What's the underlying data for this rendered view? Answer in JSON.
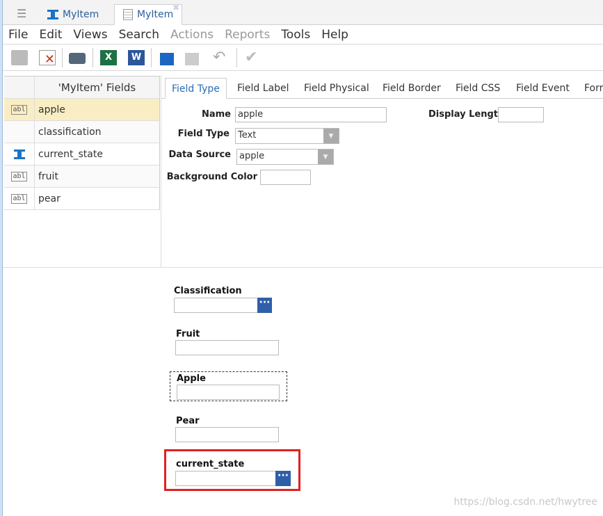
{
  "tabs": [
    {
      "label": "MyItem",
      "icon": "item-type-icon"
    },
    {
      "label": "MyItem",
      "icon": "form-icon",
      "active": true
    }
  ],
  "menu": [
    {
      "label": "File"
    },
    {
      "label": "Edit"
    },
    {
      "label": "Views"
    },
    {
      "label": "Search"
    },
    {
      "label": "Actions",
      "disabled": true
    },
    {
      "label": "Reports",
      "disabled": true
    },
    {
      "label": "Tools"
    },
    {
      "label": "Help"
    }
  ],
  "toolbar": [
    "save-icon",
    "discard-icon",
    "print-icon",
    "excel-icon",
    "word-icon",
    "lock-icon",
    "unlock-icon",
    "undo-icon",
    "done-icon"
  ],
  "fields_grid": {
    "header": "'MyItem' Fields",
    "rows": [
      {
        "name": "apple",
        "icon": "text-field-icon",
        "selected": true
      },
      {
        "name": "classification",
        "icon": ""
      },
      {
        "name": "current_state",
        "icon": "item-type-icon"
      },
      {
        "name": "fruit",
        "icon": "text-field-icon"
      },
      {
        "name": "pear",
        "icon": "text-field-icon"
      }
    ]
  },
  "prop_tabs": [
    "Field Type",
    "Field Label",
    "Field Physical",
    "Field Border",
    "Field CSS",
    "Field Event",
    "Forr"
  ],
  "props": {
    "name_label": "Name",
    "name_value": "apple",
    "field_type_label": "Field Type",
    "field_type_value": "Text",
    "data_source_label": "Data Source",
    "data_source_value": "apple",
    "bg_color_label": "Background Color",
    "bg_color_value": "",
    "display_length_label": "Display Length",
    "display_length_value": ""
  },
  "form": {
    "classification": "Classification",
    "fruit": "Fruit",
    "apple": "Apple",
    "pear": "Pear",
    "current_state": "current_state",
    "ellipsis": "···"
  },
  "watermark": "https://blog.csdn.net/hwytree",
  "colors": {
    "accent": "#2b6bb5",
    "selected_row": "#f9edc3",
    "highlight_box": "#e02020"
  }
}
